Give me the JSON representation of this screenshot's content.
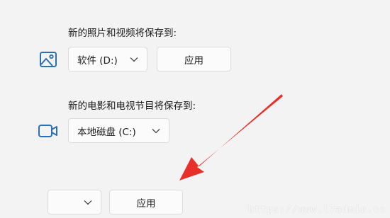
{
  "photos_section": {
    "label": "新的照片和视频将保存到:",
    "icon": "image-icon",
    "drive_value": "软件 (D:)",
    "apply_label": "应用"
  },
  "movies_section": {
    "label": "新的电影和电视节目将保存到:",
    "icon": "video-camera-icon",
    "drive_value": "本地磁盘 (C:)"
  },
  "bottom_section": {
    "drive_value": "",
    "apply_label": "应用"
  },
  "annotation": {
    "arrow_color": "#e8302b"
  },
  "watermark": {
    "text": "https://www.l7admin.cc"
  },
  "colors": {
    "icon_accent": "#2d6fb0",
    "background": "#f3f3f3"
  }
}
